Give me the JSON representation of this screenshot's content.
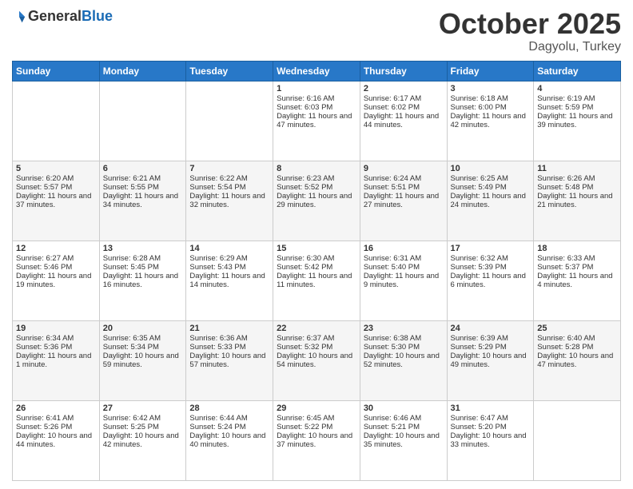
{
  "header": {
    "logo": {
      "general": "General",
      "blue": "Blue"
    },
    "title": "October 2025",
    "location": "Dagyolu, Turkey"
  },
  "days_of_week": [
    "Sunday",
    "Monday",
    "Tuesday",
    "Wednesday",
    "Thursday",
    "Friday",
    "Saturday"
  ],
  "weeks": [
    {
      "days": [
        {
          "num": "",
          "info": ""
        },
        {
          "num": "",
          "info": ""
        },
        {
          "num": "",
          "info": ""
        },
        {
          "num": "1",
          "info": "Sunrise: 6:16 AM\nSunset: 6:03 PM\nDaylight: 11 hours and 47 minutes."
        },
        {
          "num": "2",
          "info": "Sunrise: 6:17 AM\nSunset: 6:02 PM\nDaylight: 11 hours and 44 minutes."
        },
        {
          "num": "3",
          "info": "Sunrise: 6:18 AM\nSunset: 6:00 PM\nDaylight: 11 hours and 42 minutes."
        },
        {
          "num": "4",
          "info": "Sunrise: 6:19 AM\nSunset: 5:59 PM\nDaylight: 11 hours and 39 minutes."
        }
      ]
    },
    {
      "days": [
        {
          "num": "5",
          "info": "Sunrise: 6:20 AM\nSunset: 5:57 PM\nDaylight: 11 hours and 37 minutes."
        },
        {
          "num": "6",
          "info": "Sunrise: 6:21 AM\nSunset: 5:55 PM\nDaylight: 11 hours and 34 minutes."
        },
        {
          "num": "7",
          "info": "Sunrise: 6:22 AM\nSunset: 5:54 PM\nDaylight: 11 hours and 32 minutes."
        },
        {
          "num": "8",
          "info": "Sunrise: 6:23 AM\nSunset: 5:52 PM\nDaylight: 11 hours and 29 minutes."
        },
        {
          "num": "9",
          "info": "Sunrise: 6:24 AM\nSunset: 5:51 PM\nDaylight: 11 hours and 27 minutes."
        },
        {
          "num": "10",
          "info": "Sunrise: 6:25 AM\nSunset: 5:49 PM\nDaylight: 11 hours and 24 minutes."
        },
        {
          "num": "11",
          "info": "Sunrise: 6:26 AM\nSunset: 5:48 PM\nDaylight: 11 hours and 21 minutes."
        }
      ]
    },
    {
      "days": [
        {
          "num": "12",
          "info": "Sunrise: 6:27 AM\nSunset: 5:46 PM\nDaylight: 11 hours and 19 minutes."
        },
        {
          "num": "13",
          "info": "Sunrise: 6:28 AM\nSunset: 5:45 PM\nDaylight: 11 hours and 16 minutes."
        },
        {
          "num": "14",
          "info": "Sunrise: 6:29 AM\nSunset: 5:43 PM\nDaylight: 11 hours and 14 minutes."
        },
        {
          "num": "15",
          "info": "Sunrise: 6:30 AM\nSunset: 5:42 PM\nDaylight: 11 hours and 11 minutes."
        },
        {
          "num": "16",
          "info": "Sunrise: 6:31 AM\nSunset: 5:40 PM\nDaylight: 11 hours and 9 minutes."
        },
        {
          "num": "17",
          "info": "Sunrise: 6:32 AM\nSunset: 5:39 PM\nDaylight: 11 hours and 6 minutes."
        },
        {
          "num": "18",
          "info": "Sunrise: 6:33 AM\nSunset: 5:37 PM\nDaylight: 11 hours and 4 minutes."
        }
      ]
    },
    {
      "days": [
        {
          "num": "19",
          "info": "Sunrise: 6:34 AM\nSunset: 5:36 PM\nDaylight: 11 hours and 1 minute."
        },
        {
          "num": "20",
          "info": "Sunrise: 6:35 AM\nSunset: 5:34 PM\nDaylight: 10 hours and 59 minutes."
        },
        {
          "num": "21",
          "info": "Sunrise: 6:36 AM\nSunset: 5:33 PM\nDaylight: 10 hours and 57 minutes."
        },
        {
          "num": "22",
          "info": "Sunrise: 6:37 AM\nSunset: 5:32 PM\nDaylight: 10 hours and 54 minutes."
        },
        {
          "num": "23",
          "info": "Sunrise: 6:38 AM\nSunset: 5:30 PM\nDaylight: 10 hours and 52 minutes."
        },
        {
          "num": "24",
          "info": "Sunrise: 6:39 AM\nSunset: 5:29 PM\nDaylight: 10 hours and 49 minutes."
        },
        {
          "num": "25",
          "info": "Sunrise: 6:40 AM\nSunset: 5:28 PM\nDaylight: 10 hours and 47 minutes."
        }
      ]
    },
    {
      "days": [
        {
          "num": "26",
          "info": "Sunrise: 6:41 AM\nSunset: 5:26 PM\nDaylight: 10 hours and 44 minutes."
        },
        {
          "num": "27",
          "info": "Sunrise: 6:42 AM\nSunset: 5:25 PM\nDaylight: 10 hours and 42 minutes."
        },
        {
          "num": "28",
          "info": "Sunrise: 6:44 AM\nSunset: 5:24 PM\nDaylight: 10 hours and 40 minutes."
        },
        {
          "num": "29",
          "info": "Sunrise: 6:45 AM\nSunset: 5:22 PM\nDaylight: 10 hours and 37 minutes."
        },
        {
          "num": "30",
          "info": "Sunrise: 6:46 AM\nSunset: 5:21 PM\nDaylight: 10 hours and 35 minutes."
        },
        {
          "num": "31",
          "info": "Sunrise: 6:47 AM\nSunset: 5:20 PM\nDaylight: 10 hours and 33 minutes."
        },
        {
          "num": "",
          "info": ""
        }
      ]
    }
  ]
}
